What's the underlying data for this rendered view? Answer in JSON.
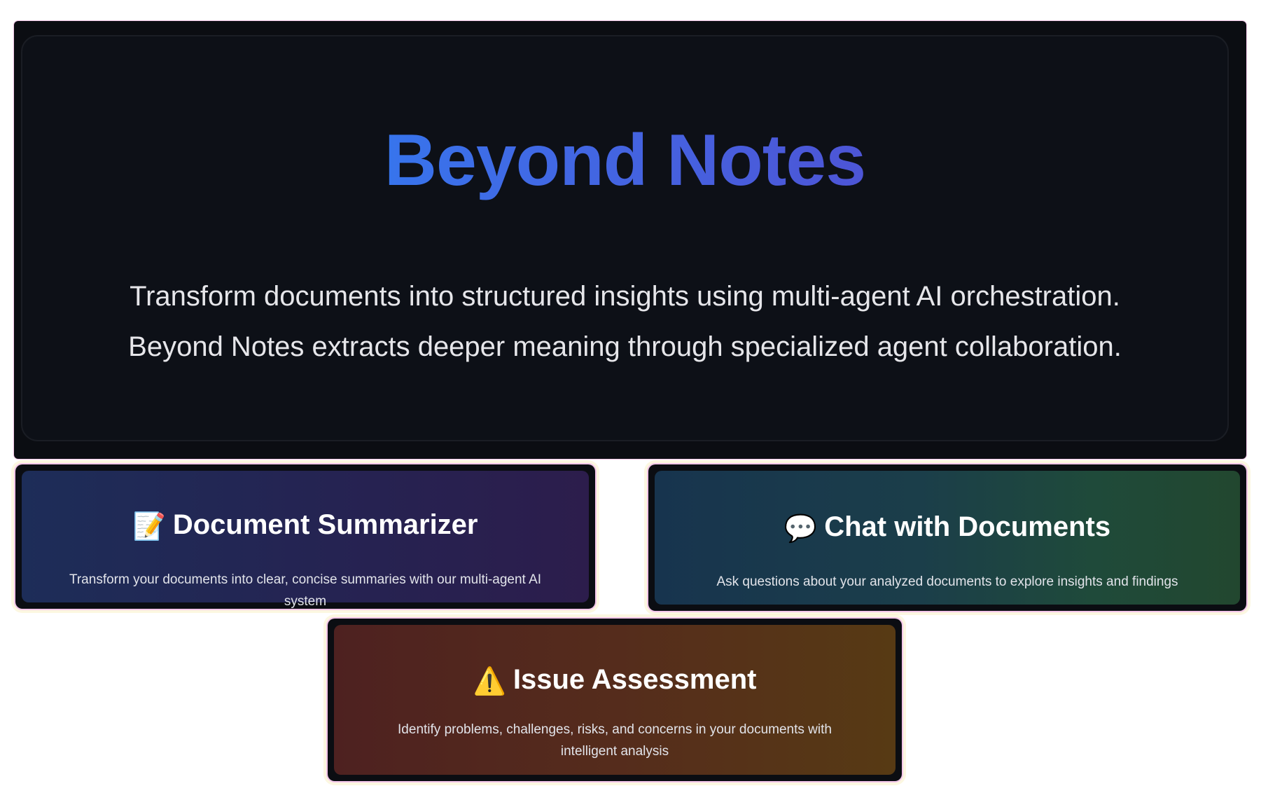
{
  "hero": {
    "title": "Beyond Notes",
    "description_line1": "Transform documents into structured insights using multi-agent AI orchestration.",
    "description_line2": "Beyond Notes extracts deeper meaning through specialized agent collaboration."
  },
  "cards": [
    {
      "icon": "memo-icon",
      "emoji": "📝",
      "title": "Document Summarizer",
      "description": "Transform your documents into clear, concise summaries with our multi-agent AI system"
    },
    {
      "icon": "speech-bubble-icon",
      "emoji": "💬",
      "title": "Chat with Documents",
      "description": "Ask questions about your analyzed documents to explore insights and findings"
    },
    {
      "icon": "warning-icon",
      "emoji": "⚠️",
      "title": "Issue Assessment",
      "description": "Identify problems, challenges, risks, and concerns in your documents with intelligent analysis"
    }
  ],
  "colors": {
    "background": "#0b0d12",
    "title_gradient_start": "#1e90ff",
    "title_gradient_end": "#6a3fc6",
    "card_summarizer": "#232750",
    "card_chat": "#1b3f46",
    "card_issue": "#552d1b"
  }
}
